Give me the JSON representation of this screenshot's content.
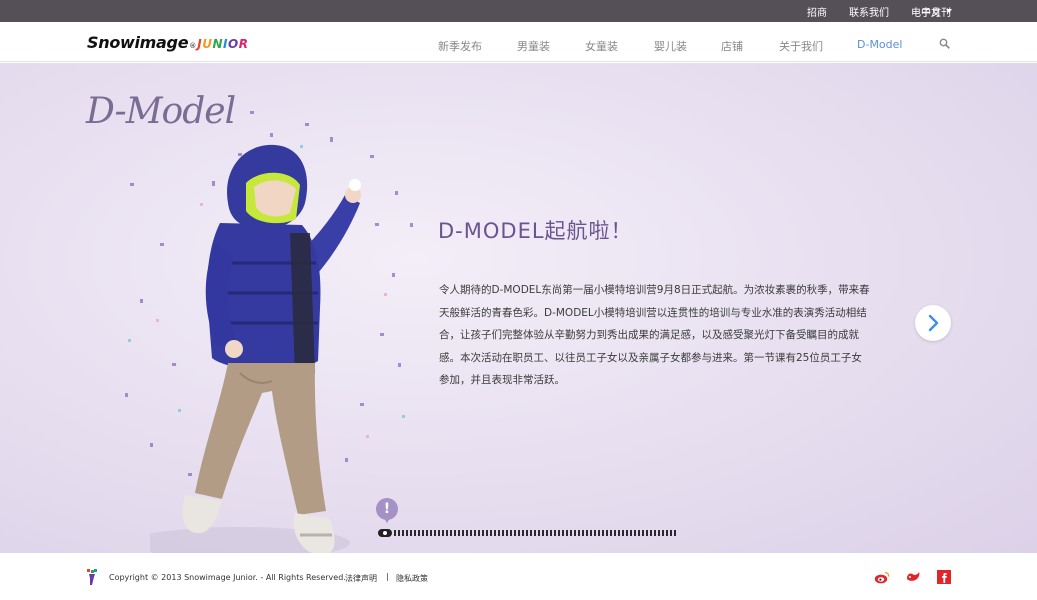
{
  "topbar": {
    "links": [
      "招商",
      "联系我们",
      "电子月刊"
    ],
    "language": "中文"
  },
  "header": {
    "logo": {
      "brand": "Snowimage",
      "reg": "®",
      "junior": [
        "J",
        "U",
        "N",
        "I",
        "O",
        "R"
      ]
    },
    "nav": [
      "新季发布",
      "男童装",
      "女童装",
      "婴儿装",
      "店铺",
      "关于我们",
      "D-Model"
    ],
    "active_nav": "D-Model"
  },
  "hero": {
    "script_title": "D-Model",
    "headline": "D-MODEL起航啦！",
    "body": "令人期待的D-MODEL东尚第一届小模特培训营9月8日正式起航。为浓妆素裹的秋季，带来春天般鲜活的青春色彩。D-MODEL小模特培训营以连贯性的培训与专业水准的表演秀活动相结合，让孩子们完整体验从辛勤努力到秀出成果的满足感，以及感受聚光灯下备受瞩目的成就感。本次活动在职员工、以往员工子女以及亲属子女都参与进来。第一节课有25位员工子女参加，并且表现非常活跃。",
    "timeline_marker": "!"
  },
  "footer": {
    "copyright": "Copyright © 2013 Snowimage Junior. - All Rights Reserved.",
    "legal": "法律声明",
    "separator": "|",
    "privacy": "隐私政策"
  },
  "colors": {
    "topbar": "#554f58",
    "accent": "#5b8fd9",
    "headline": "#6a5590",
    "hero_bg": "#e9e1f1",
    "social_red": "#e0262a"
  },
  "icons": [
    "search-icon",
    "chevron-right-icon",
    "weibo-icon",
    "tencent-weibo-icon",
    "facebook-icon",
    "exclamation-icon"
  ]
}
